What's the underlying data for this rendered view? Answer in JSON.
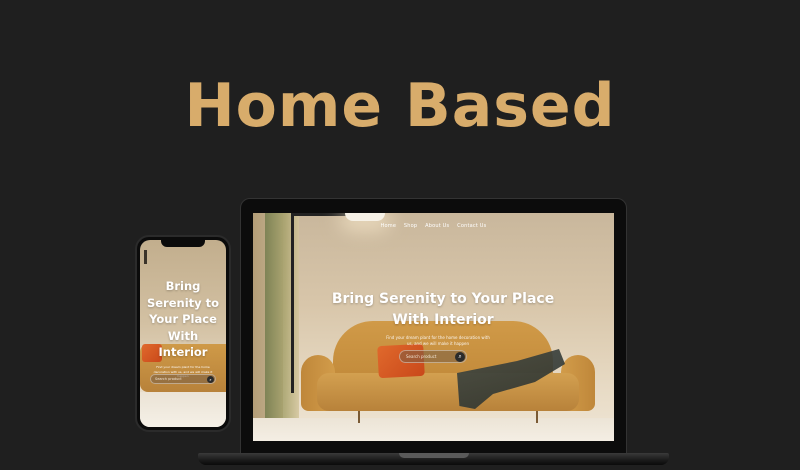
{
  "headline": "Home Based",
  "laptop": {
    "nav": [
      "Home",
      "Shop",
      "About Us",
      "Contact Us"
    ],
    "hero_title_line1": "Bring Serenity to Your Place",
    "hero_title_line2": "With Interior",
    "hero_subtitle": "Find your dream plant for the home decoration with us, and we will make it happen",
    "search_placeholder": "Search product",
    "search_icon": "search-icon"
  },
  "phone": {
    "hero_title_line1": "Bring",
    "hero_title_line2": "Serenity to",
    "hero_title_line3": "Your Place",
    "hero_title_line4": "With",
    "hero_title_line5": "Interior",
    "hero_subtitle": "Find your dream plant for the home decoration with us, and we will make it happen",
    "search_placeholder": "Search product",
    "search_icon": "search-icon"
  },
  "colors": {
    "background": "#1f1f1f",
    "headline": "#d8ac6b"
  }
}
